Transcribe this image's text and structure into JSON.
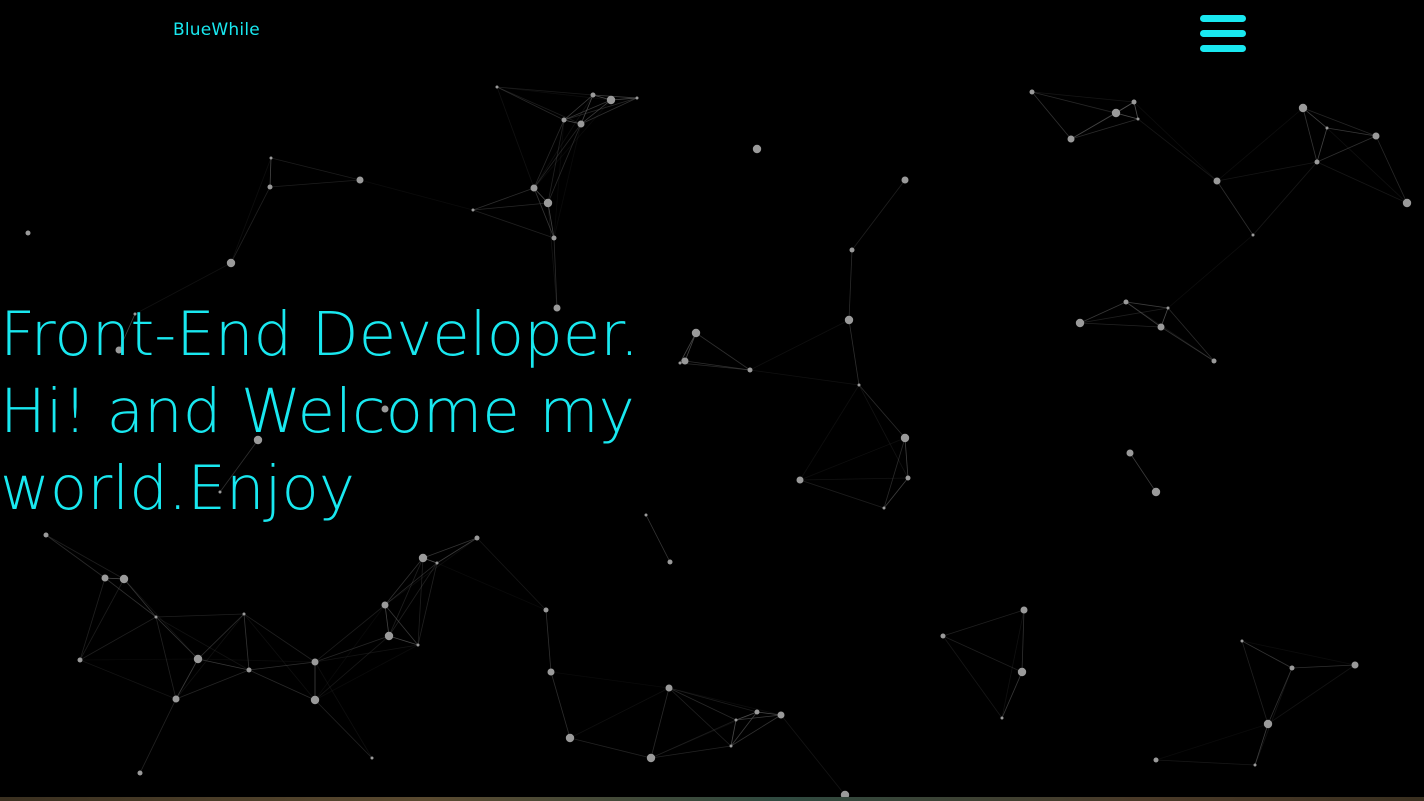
{
  "header": {
    "brand": "BlueWhile",
    "menu_icon": "hamburger-menu-icon"
  },
  "hero": {
    "lines": [
      "Front-End Developer.",
      "Hi! and Welcome my",
      "world.Enjoy"
    ]
  },
  "colors": {
    "background": "#000000",
    "accent": "#19e8f0",
    "network_node": "#9a9a9a",
    "network_line": "#5a5a5a"
  }
}
